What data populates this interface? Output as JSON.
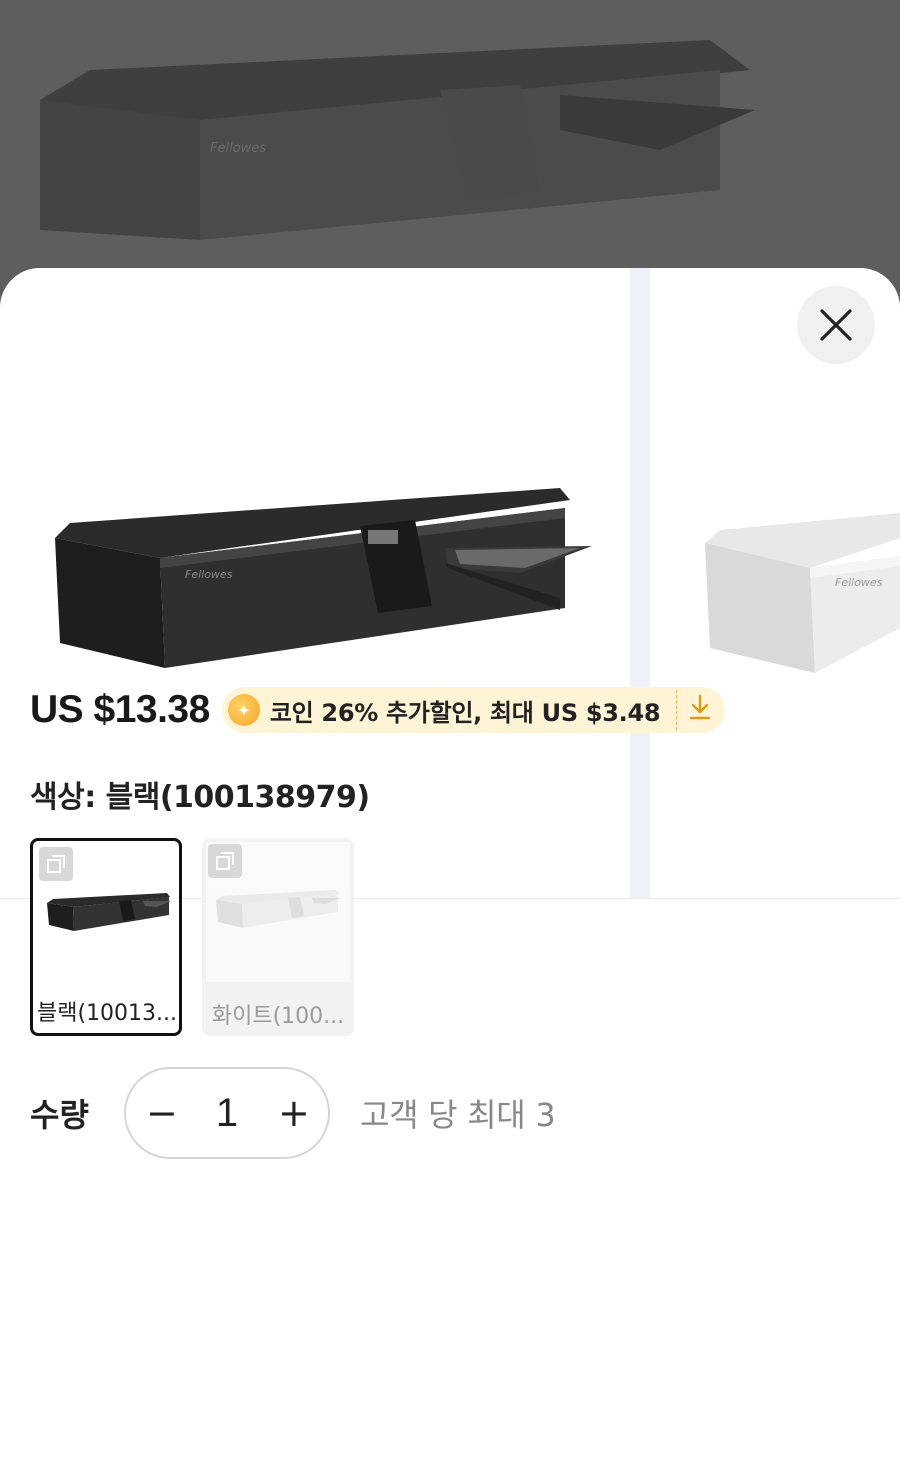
{
  "product": {
    "brand_mark": "Fellowes",
    "price": "US $13.38",
    "coin_promo": {
      "text": "코인 26% 추가할인, 최대 US $3.48",
      "icon": "coin-icon",
      "action_icon": "download-icon"
    }
  },
  "variant": {
    "label": "색상: 블랙(100138979)",
    "options": [
      {
        "label": "블랙(10013...",
        "selected": true,
        "available": true
      },
      {
        "label": "화이트(100...",
        "selected": false,
        "available": false
      }
    ]
  },
  "quantity": {
    "label": "수량",
    "decrement": "−",
    "value": "1",
    "increment": "+",
    "limit_text": "고객 당 최대 3"
  },
  "colors": {
    "accent_gold": "#f5a623",
    "promo_bg": "#fff4d6",
    "text_primary": "#191919"
  }
}
